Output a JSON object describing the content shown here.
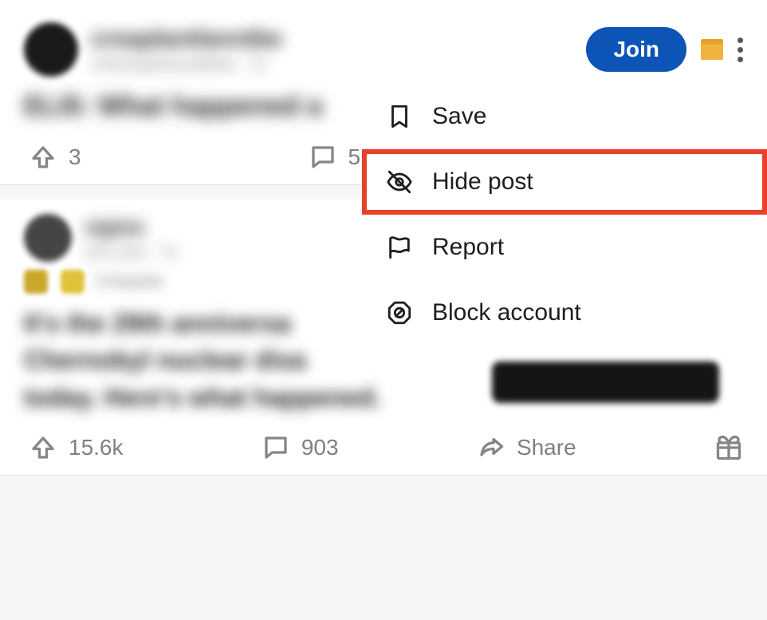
{
  "header": {
    "join_label": "Join"
  },
  "post1": {
    "subreddit": "creaplantlanntbe",
    "meta": "urthehaphitezoblbae · 7y",
    "title": "ELI5: What happened a",
    "upvotes": "3",
    "comments": "5"
  },
  "post2": {
    "subreddit": "vipire",
    "meta": "u/R_bart · 7y",
    "awards": "8 Awards",
    "title": "It's the 29th anniversa\nChernobyl nuclear disa\ntoday. Here's what happened.",
    "upvotes": "15.6k",
    "comments": "903",
    "share_label": "Share"
  },
  "menu": {
    "save": "Save",
    "hide": "Hide post",
    "report": "Report",
    "block": "Block account"
  }
}
